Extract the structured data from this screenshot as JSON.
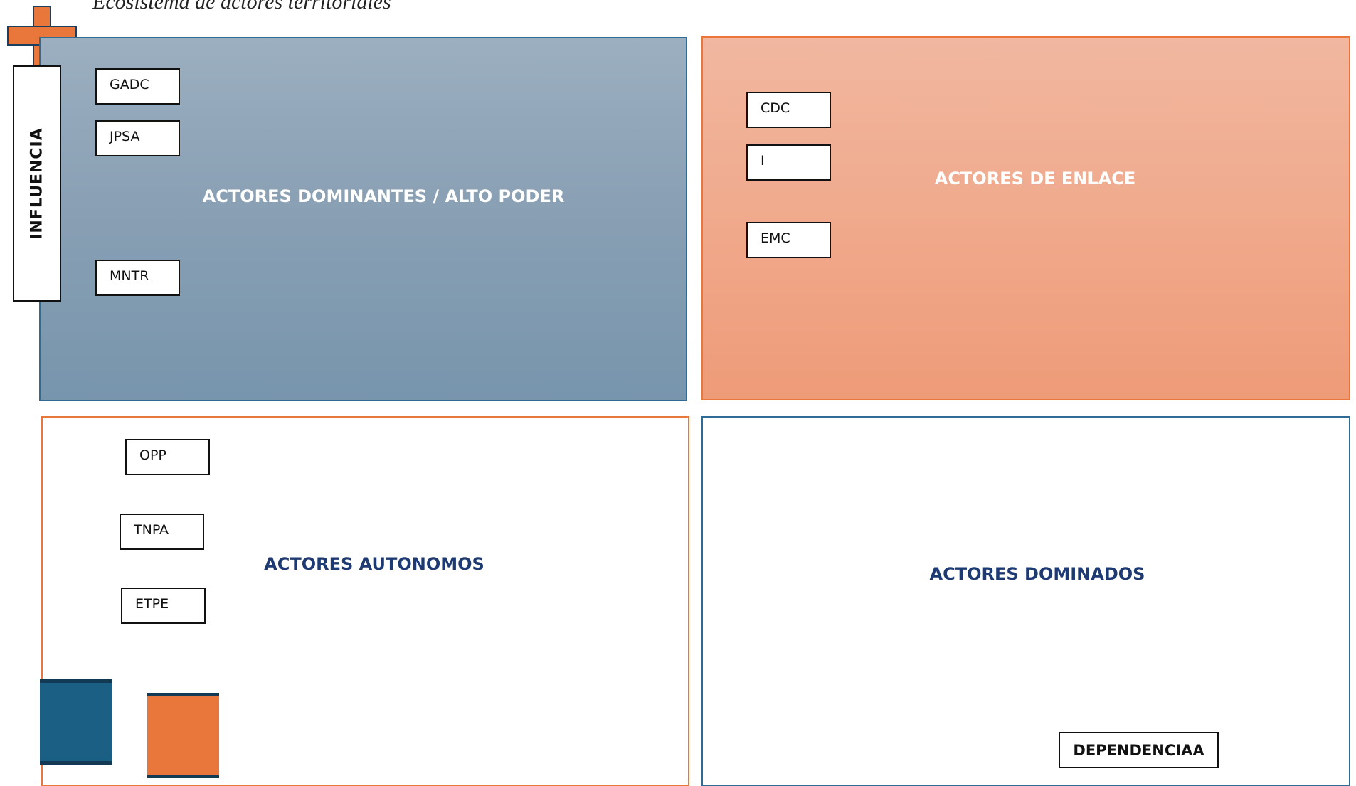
{
  "caption": "Ecosistema de actores territoriales",
  "axes": {
    "influence_label": "INFLUENCIA",
    "dependence_label": "DEPENDENCIAA"
  },
  "quadrants": {
    "dominant": {
      "label": "ACTORES DOMINANTES / ALTO PODER",
      "actors": [
        "GADC",
        "JPSA",
        "MNTR"
      ]
    },
    "link": {
      "label": "ACTORES DE ENLACE",
      "actors": [
        "CDC",
        "I",
        "EMC"
      ]
    },
    "autonomous": {
      "label": "ACTORES AUTONOMOS",
      "actors": [
        "OPP",
        "TNPA",
        "ETPE"
      ]
    },
    "dominated": {
      "label": "ACTORES DOMINADOS",
      "actors": []
    }
  },
  "colors": {
    "blue": "#1c5f85",
    "orange": "#e9773c",
    "dominant_fill": "#8aa0b4",
    "link_fill": "#f0a88a",
    "navy_text": "#1d3a73"
  },
  "icons": {
    "corner_mark": "plus-icon",
    "legend_blue": "blue-legend-swatch",
    "legend_orange": "orange-legend-swatch"
  }
}
